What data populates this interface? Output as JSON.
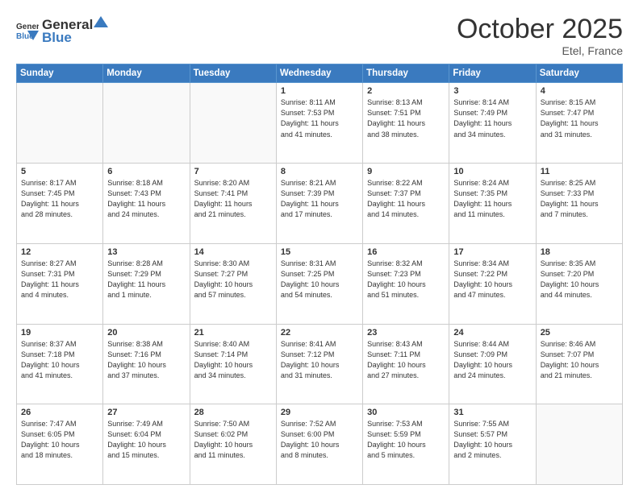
{
  "logo": {
    "general": "General",
    "blue": "Blue"
  },
  "header": {
    "month": "October 2025",
    "location": "Etel, France"
  },
  "days_of_week": [
    "Sunday",
    "Monday",
    "Tuesday",
    "Wednesday",
    "Thursday",
    "Friday",
    "Saturday"
  ],
  "weeks": [
    {
      "days": [
        {
          "number": "",
          "info": ""
        },
        {
          "number": "",
          "info": ""
        },
        {
          "number": "",
          "info": ""
        },
        {
          "number": "1",
          "info": "Sunrise: 8:11 AM\nSunset: 7:53 PM\nDaylight: 11 hours\nand 41 minutes."
        },
        {
          "number": "2",
          "info": "Sunrise: 8:13 AM\nSunset: 7:51 PM\nDaylight: 11 hours\nand 38 minutes."
        },
        {
          "number": "3",
          "info": "Sunrise: 8:14 AM\nSunset: 7:49 PM\nDaylight: 11 hours\nand 34 minutes."
        },
        {
          "number": "4",
          "info": "Sunrise: 8:15 AM\nSunset: 7:47 PM\nDaylight: 11 hours\nand 31 minutes."
        }
      ]
    },
    {
      "days": [
        {
          "number": "5",
          "info": "Sunrise: 8:17 AM\nSunset: 7:45 PM\nDaylight: 11 hours\nand 28 minutes."
        },
        {
          "number": "6",
          "info": "Sunrise: 8:18 AM\nSunset: 7:43 PM\nDaylight: 11 hours\nand 24 minutes."
        },
        {
          "number": "7",
          "info": "Sunrise: 8:20 AM\nSunset: 7:41 PM\nDaylight: 11 hours\nand 21 minutes."
        },
        {
          "number": "8",
          "info": "Sunrise: 8:21 AM\nSunset: 7:39 PM\nDaylight: 11 hours\nand 17 minutes."
        },
        {
          "number": "9",
          "info": "Sunrise: 8:22 AM\nSunset: 7:37 PM\nDaylight: 11 hours\nand 14 minutes."
        },
        {
          "number": "10",
          "info": "Sunrise: 8:24 AM\nSunset: 7:35 PM\nDaylight: 11 hours\nand 11 minutes."
        },
        {
          "number": "11",
          "info": "Sunrise: 8:25 AM\nSunset: 7:33 PM\nDaylight: 11 hours\nand 7 minutes."
        }
      ]
    },
    {
      "days": [
        {
          "number": "12",
          "info": "Sunrise: 8:27 AM\nSunset: 7:31 PM\nDaylight: 11 hours\nand 4 minutes."
        },
        {
          "number": "13",
          "info": "Sunrise: 8:28 AM\nSunset: 7:29 PM\nDaylight: 11 hours\nand 1 minute."
        },
        {
          "number": "14",
          "info": "Sunrise: 8:30 AM\nSunset: 7:27 PM\nDaylight: 10 hours\nand 57 minutes."
        },
        {
          "number": "15",
          "info": "Sunrise: 8:31 AM\nSunset: 7:25 PM\nDaylight: 10 hours\nand 54 minutes."
        },
        {
          "number": "16",
          "info": "Sunrise: 8:32 AM\nSunset: 7:23 PM\nDaylight: 10 hours\nand 51 minutes."
        },
        {
          "number": "17",
          "info": "Sunrise: 8:34 AM\nSunset: 7:22 PM\nDaylight: 10 hours\nand 47 minutes."
        },
        {
          "number": "18",
          "info": "Sunrise: 8:35 AM\nSunset: 7:20 PM\nDaylight: 10 hours\nand 44 minutes."
        }
      ]
    },
    {
      "days": [
        {
          "number": "19",
          "info": "Sunrise: 8:37 AM\nSunset: 7:18 PM\nDaylight: 10 hours\nand 41 minutes."
        },
        {
          "number": "20",
          "info": "Sunrise: 8:38 AM\nSunset: 7:16 PM\nDaylight: 10 hours\nand 37 minutes."
        },
        {
          "number": "21",
          "info": "Sunrise: 8:40 AM\nSunset: 7:14 PM\nDaylight: 10 hours\nand 34 minutes."
        },
        {
          "number": "22",
          "info": "Sunrise: 8:41 AM\nSunset: 7:12 PM\nDaylight: 10 hours\nand 31 minutes."
        },
        {
          "number": "23",
          "info": "Sunrise: 8:43 AM\nSunset: 7:11 PM\nDaylight: 10 hours\nand 27 minutes."
        },
        {
          "number": "24",
          "info": "Sunrise: 8:44 AM\nSunset: 7:09 PM\nDaylight: 10 hours\nand 24 minutes."
        },
        {
          "number": "25",
          "info": "Sunrise: 8:46 AM\nSunset: 7:07 PM\nDaylight: 10 hours\nand 21 minutes."
        }
      ]
    },
    {
      "days": [
        {
          "number": "26",
          "info": "Sunrise: 7:47 AM\nSunset: 6:05 PM\nDaylight: 10 hours\nand 18 minutes."
        },
        {
          "number": "27",
          "info": "Sunrise: 7:49 AM\nSunset: 6:04 PM\nDaylight: 10 hours\nand 15 minutes."
        },
        {
          "number": "28",
          "info": "Sunrise: 7:50 AM\nSunset: 6:02 PM\nDaylight: 10 hours\nand 11 minutes."
        },
        {
          "number": "29",
          "info": "Sunrise: 7:52 AM\nSunset: 6:00 PM\nDaylight: 10 hours\nand 8 minutes."
        },
        {
          "number": "30",
          "info": "Sunrise: 7:53 AM\nSunset: 5:59 PM\nDaylight: 10 hours\nand 5 minutes."
        },
        {
          "number": "31",
          "info": "Sunrise: 7:55 AM\nSunset: 5:57 PM\nDaylight: 10 hours\nand 2 minutes."
        },
        {
          "number": "",
          "info": ""
        }
      ]
    }
  ]
}
